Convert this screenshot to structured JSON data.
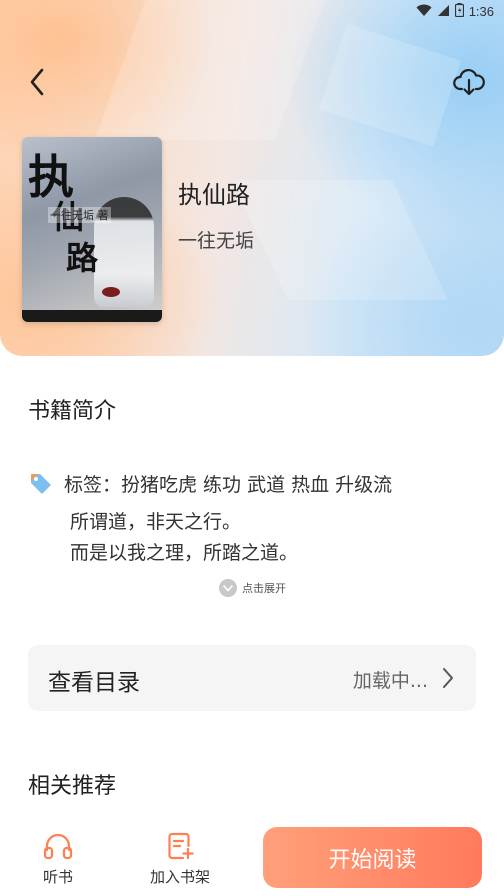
{
  "status_bar": {
    "time": "1:36"
  },
  "book": {
    "title": "执仙路",
    "author": "一往无垢"
  },
  "cover": {
    "title_1": "执",
    "title_2": "仙",
    "title_3": "路",
    "author": "一往无垢 著"
  },
  "intro": {
    "section_title": "书籍简介",
    "tags": "标签：扮猪吃虎 练功 武道 热血 升级流",
    "lines": [
      "所谓道，非天之行。",
      "而是以我之理，所踏之道。"
    ],
    "expand_label": "点击展开"
  },
  "catalog": {
    "label": "查看目录",
    "status": "加载中..."
  },
  "recommendations": {
    "section_title": "相关推荐"
  },
  "bottom_bar": {
    "listen_label": "听书",
    "shelf_label": "加入书架",
    "start_label": "开始阅读"
  },
  "colors": {
    "accent": "#ff7a5c",
    "accent_light": "#ffa07a",
    "icon_orange": "#ff7f50"
  }
}
